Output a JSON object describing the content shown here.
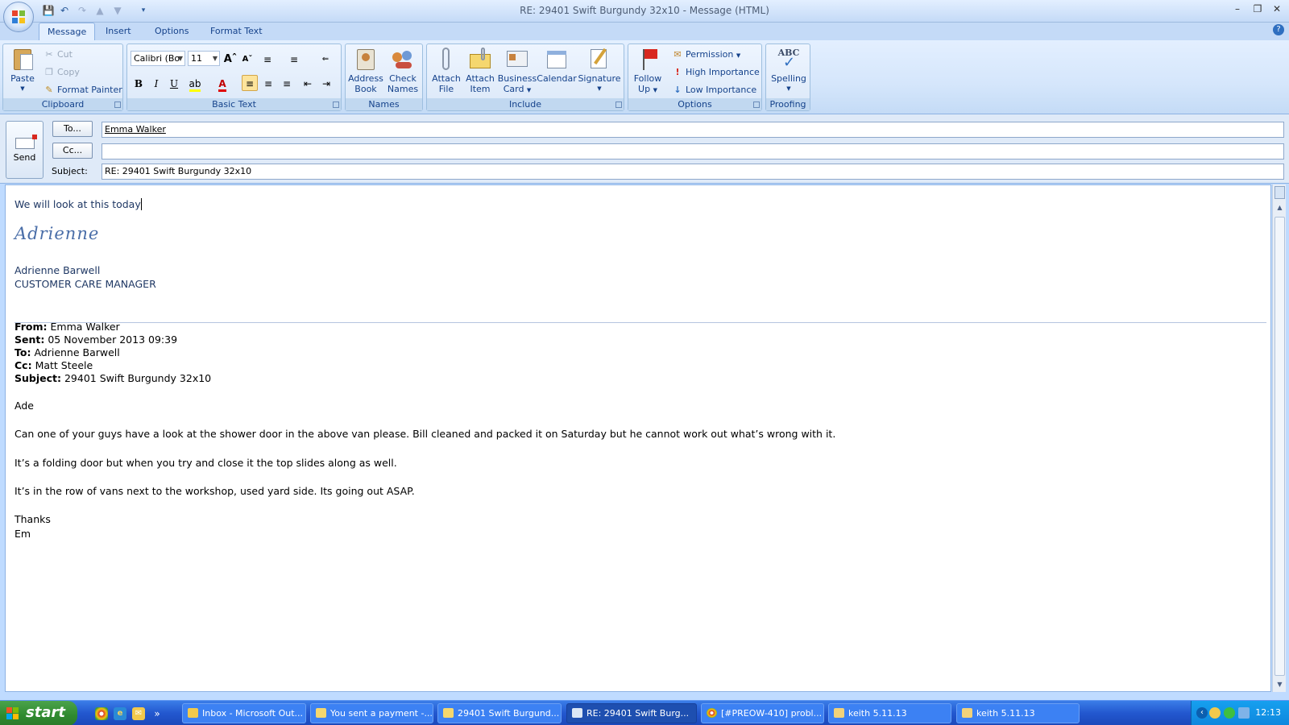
{
  "window": {
    "title": "RE: 29401 Swift Burgundy 32x10 - Message (HTML)"
  },
  "tabs": [
    "Message",
    "Insert",
    "Options",
    "Format Text"
  ],
  "ribbon": {
    "clipboard": {
      "label": "Clipboard",
      "paste": "Paste",
      "cut": "Cut",
      "copy": "Copy",
      "format_painter": "Format Painter"
    },
    "basic_text": {
      "label": "Basic Text",
      "font": "Calibri (Bo",
      "size": "11",
      "bold": "B",
      "italic": "I",
      "underline": "U"
    },
    "names": {
      "label": "Names",
      "address_book_1": "Address",
      "address_book_2": "Book",
      "check_names_1": "Check",
      "check_names_2": "Names"
    },
    "include": {
      "label": "Include",
      "attach_file_1": "Attach",
      "attach_file_2": "File",
      "attach_item_1": "Attach",
      "attach_item_2": "Item",
      "business_card_1": "Business",
      "business_card_2": "Card",
      "calendar": "Calendar",
      "signature": "Signature"
    },
    "options": {
      "label": "Options",
      "follow_up_1": "Follow",
      "follow_up_2": "Up",
      "permission": "Permission",
      "high_importance": "High Importance",
      "low_importance": "Low Importance"
    },
    "proofing": {
      "label": "Proofing",
      "spelling_icon_text": "ABC",
      "spelling": "Spelling"
    }
  },
  "header": {
    "send": "Send",
    "to_button": "To...",
    "cc_button": "Cc...",
    "subject_label": "Subject:",
    "to_value": "Emma Walker",
    "cc_value": "",
    "subject_value": "RE: 29401 Swift Burgundy 32x10"
  },
  "body": {
    "reply": "We will look at this today",
    "signature_script": "Adrienne",
    "signature_name": "Adrienne Barwell",
    "signature_title": "CUSTOMER CARE MANAGER",
    "original": {
      "from_label": "From:",
      "from": "Emma Walker",
      "sent_label": "Sent:",
      "sent": "05 November 2013 09:39",
      "to_label": "To:",
      "to": "Adrienne Barwell",
      "cc_label": "Cc:",
      "cc": "Matt Steele",
      "subject_label": "Subject:",
      "subject": "29401 Swift Burgundy 32x10",
      "greeting": "Ade",
      "p1": "Can one of your guys have a look at the shower door in the above van please.  Bill cleaned and packed it on Saturday but he cannot work out what’s wrong with it.",
      "p2": "It’s a folding door but when you try and close it the top slides along as well.",
      "p3": "It’s in the row of vans next to the workshop, used yard side. Its going out ASAP.",
      "thanks": "Thanks",
      "sign": "Em"
    }
  },
  "taskbar": {
    "start": "start",
    "tasks": [
      "Inbox - Microsoft Out...",
      "You sent a payment -...",
      "29401 Swift Burgund...",
      "RE: 29401 Swift Burg...",
      "[#PREOW-410] probl...",
      "keith 5.11.13",
      "keith 5.11.13"
    ],
    "clock": "12:13"
  }
}
